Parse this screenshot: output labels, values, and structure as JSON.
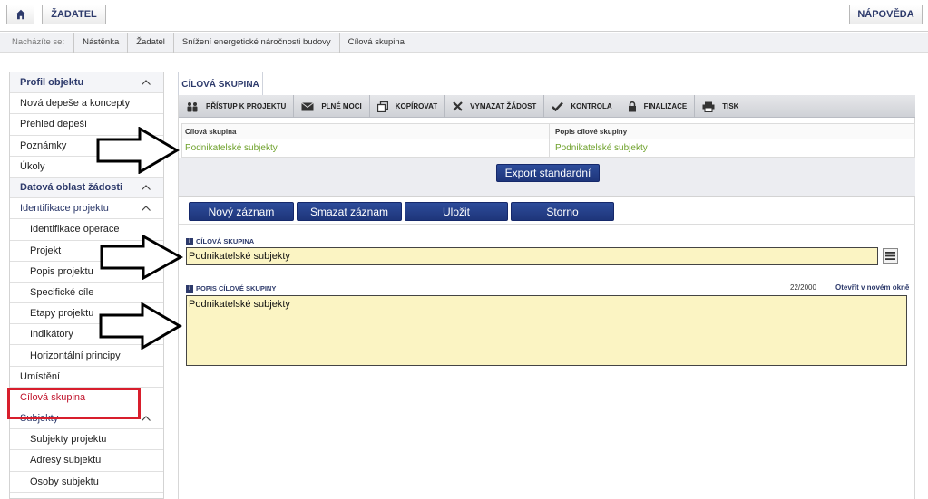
{
  "topbar": {
    "zadatel_label": "ŽADATEL",
    "napoveda_label": "NÁPOVĚDA"
  },
  "breadcrumb": {
    "label": "Nacházíte se:",
    "items": [
      "Nástěnka",
      "Žadatel",
      "Snížení energetické náročnosti budovy",
      "Cílová skupina"
    ]
  },
  "sidebar": {
    "items": [
      {
        "label": "Profil objektu"
      },
      {
        "label": "Nová depeše a koncepty"
      },
      {
        "label": "Přehled depeší"
      },
      {
        "label": "Poznámky"
      },
      {
        "label": "Úkoly"
      },
      {
        "label": "Datová oblast žádosti"
      },
      {
        "label": "Identifikace projektu"
      },
      {
        "label": "Identifikace operace"
      },
      {
        "label": "Projekt"
      },
      {
        "label": "Popis projektu"
      },
      {
        "label": "Specifické cíle"
      },
      {
        "label": "Etapy projektu"
      },
      {
        "label": "Indikátory"
      },
      {
        "label": "Horizontální principy"
      },
      {
        "label": "Umístění"
      },
      {
        "label": "Cílová skupina"
      },
      {
        "label": "Subjekty"
      },
      {
        "label": "Subjekty projektu"
      },
      {
        "label": "Adresy subjektu"
      },
      {
        "label": "Osoby subjektu"
      }
    ]
  },
  "tab": {
    "label": "CÍLOVÁ SKUPINA"
  },
  "toolbar": {
    "items": [
      {
        "label": "PŘÍSTUP K PROJEKTU",
        "icon": "people-icon"
      },
      {
        "label": "PLNÉ MOCI",
        "icon": "envelope-icon"
      },
      {
        "label": "KOPÍROVAT",
        "icon": "copy-icon"
      },
      {
        "label": "VYMAZAT ŽÁDOST",
        "icon": "x-icon"
      },
      {
        "label": "KONTROLA",
        "icon": "check-icon"
      },
      {
        "label": "FINALIZACE",
        "icon": "lock-icon"
      },
      {
        "label": "TISK",
        "icon": "printer-icon"
      }
    ]
  },
  "grid": {
    "columns": [
      "Cílová skupina",
      "Popis cílové skupiny"
    ],
    "rows": [
      [
        "Podnikatelské subjekty",
        "Podnikatelské subjekty"
      ]
    ]
  },
  "buttons": {
    "export": "Export standardní",
    "novy": "Nový záznam",
    "smazat": "Smazat záznam",
    "ulozit": "Uložit",
    "storno": "Storno"
  },
  "form": {
    "cil_label": "CÍLOVÁ SKUPINA",
    "cil_value": "Podnikatelské subjekty",
    "popis_label": "POPIS CÍLOVÉ SKUPINY",
    "popis_value": "Podnikatelské subjekty",
    "counter": "22/2000",
    "open_link": "Otevřít v novém okně"
  },
  "colors": {
    "accent": "#2d3a6b",
    "button_blue": "#1e357a",
    "input_bg": "#fbf4c3",
    "highlight_red": "#d81e2c",
    "grid_text_green": "#6ea12b"
  }
}
